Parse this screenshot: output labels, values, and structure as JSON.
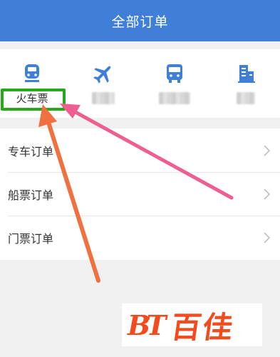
{
  "header": {
    "title": "全部订单"
  },
  "categories": {
    "train": {
      "label": "火车票",
      "icon": "train-icon",
      "selected": true
    },
    "flight": {
      "label": "",
      "icon": "airplane-icon"
    },
    "bus": {
      "label": "",
      "icon": "bus-icon"
    },
    "hotel": {
      "label": "",
      "icon": "building-icon"
    }
  },
  "menu": {
    "items": [
      {
        "label": "专车订单"
      },
      {
        "label": "船票订单"
      },
      {
        "label": "门票订单"
      }
    ]
  },
  "watermark": {
    "logo": "BT",
    "text": "百佳"
  },
  "colors": {
    "header": "#3f7fd7",
    "icon": "#3f7fd7",
    "highlight_box": "#27a81a",
    "arrow_orange": "#f07040",
    "arrow_pink": "#ee5f8f",
    "watermark": "#f34a1e"
  }
}
